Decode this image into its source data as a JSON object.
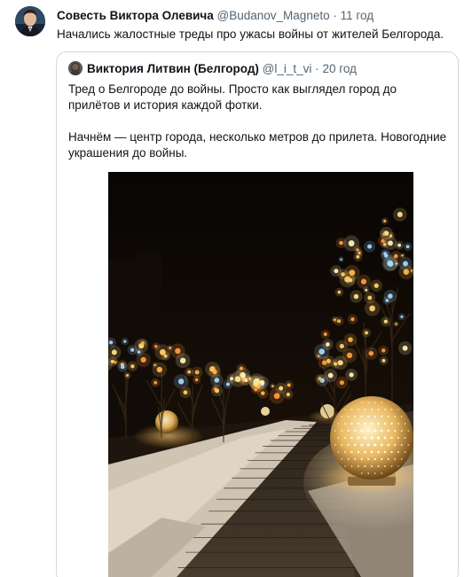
{
  "tweet": {
    "author_name": "Совесть Виктора Олевича",
    "handle": "@Budanov_Magneto",
    "separator": "·",
    "time": "11 год",
    "text": "Начались жалостные треды про ужасы войны от жителей Белгорода."
  },
  "quoted_tweet": {
    "author_name": "Виктория Литвин (Белгород)",
    "handle": "@l_i_t_vi",
    "separator": "·",
    "time": "20 год",
    "paragraphs": [
      "Тред о Белгороде до войны. Просто как выглядел город до прилётов и история каждой фотки.",
      "Начнём — центр города, несколько метров до прилета. Новогодние украшения до войны."
    ]
  },
  "colors": {
    "text_primary": "#0f1419",
    "text_secondary": "#536471",
    "border": "#cfd9de"
  }
}
